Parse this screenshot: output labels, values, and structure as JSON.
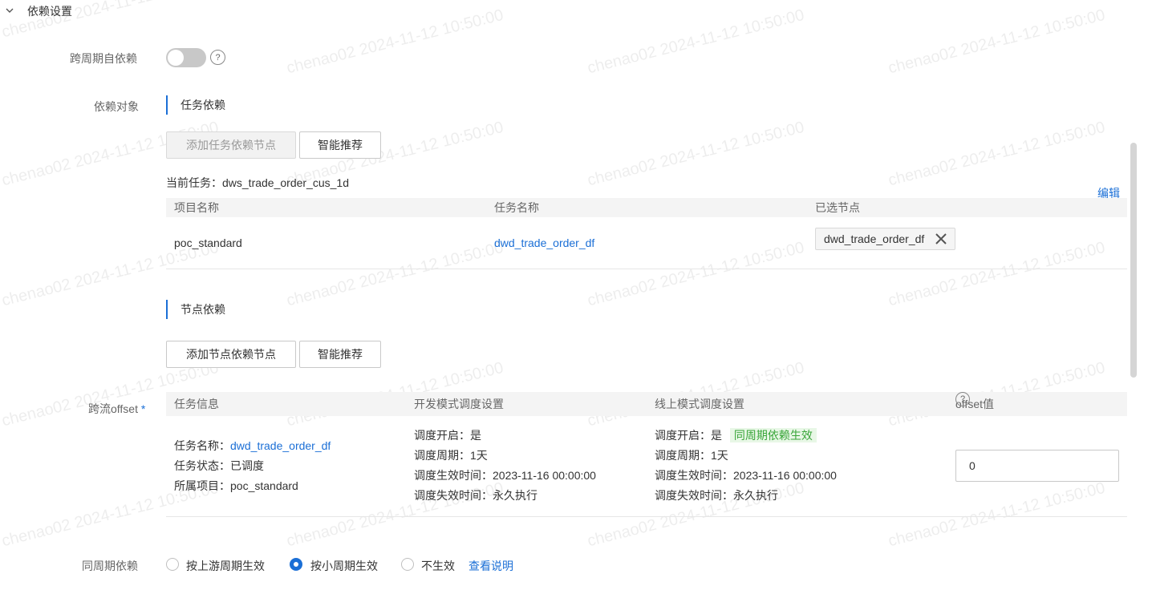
{
  "section": {
    "title": "依赖设置"
  },
  "cross_cycle": {
    "label": "跨周期自依赖",
    "help": "?"
  },
  "dep_target": {
    "label": "依赖对象"
  },
  "task_dep": {
    "title": "任务依赖",
    "add_button": "添加任务依赖节点",
    "recommend_button": "智能推荐",
    "current_task": "当前任务：dws_trade_order_cus_1d",
    "edit_link": "编辑",
    "columns": [
      "项目名称",
      "任务名称",
      "已选节点"
    ],
    "rows": [
      {
        "project": "poc_standard",
        "task": "dwd_trade_order_df",
        "node": "dwd_trade_order_df"
      }
    ]
  },
  "node_dep": {
    "title": "节点依赖",
    "add_button": "添加节点依赖节点",
    "recommend_button": "智能推荐"
  },
  "offset": {
    "label": "跨流offset",
    "required": "*",
    "columns": [
      "任务信息",
      "开发模式调度设置",
      "线上模式调度设置",
      "offset值"
    ],
    "help": "?",
    "row": {
      "task_name_label": "任务名称：",
      "task_name": "dwd_trade_order_df",
      "task_status": "任务状态：已调度",
      "task_project": "所属项目：poc_standard",
      "dev": [
        "调度开启：是",
        "调度周期：1天",
        "调度生效时间：2023-11-16 00:00:00",
        "调度失效时间：永久执行"
      ],
      "prod_enabled": "调度开启：是",
      "prod_badge": "同周期依赖生效",
      "prod": [
        "调度周期：1天",
        "调度生效时间：2023-11-16 00:00:00",
        "调度失效时间：永久执行"
      ],
      "offset_value": "0"
    }
  },
  "same_cycle": {
    "label": "同周期依赖",
    "options": [
      "按上游周期生效",
      "按小周期生效",
      "不生效"
    ],
    "selected": "按小周期生效",
    "link": "查看说明"
  },
  "watermark": "chenao02 2024-11-12 10:50:00",
  "colors": {
    "accent": "#1b6fd6",
    "badge_bg": "#e8f7e6",
    "badge_text": "#3aa63a"
  }
}
